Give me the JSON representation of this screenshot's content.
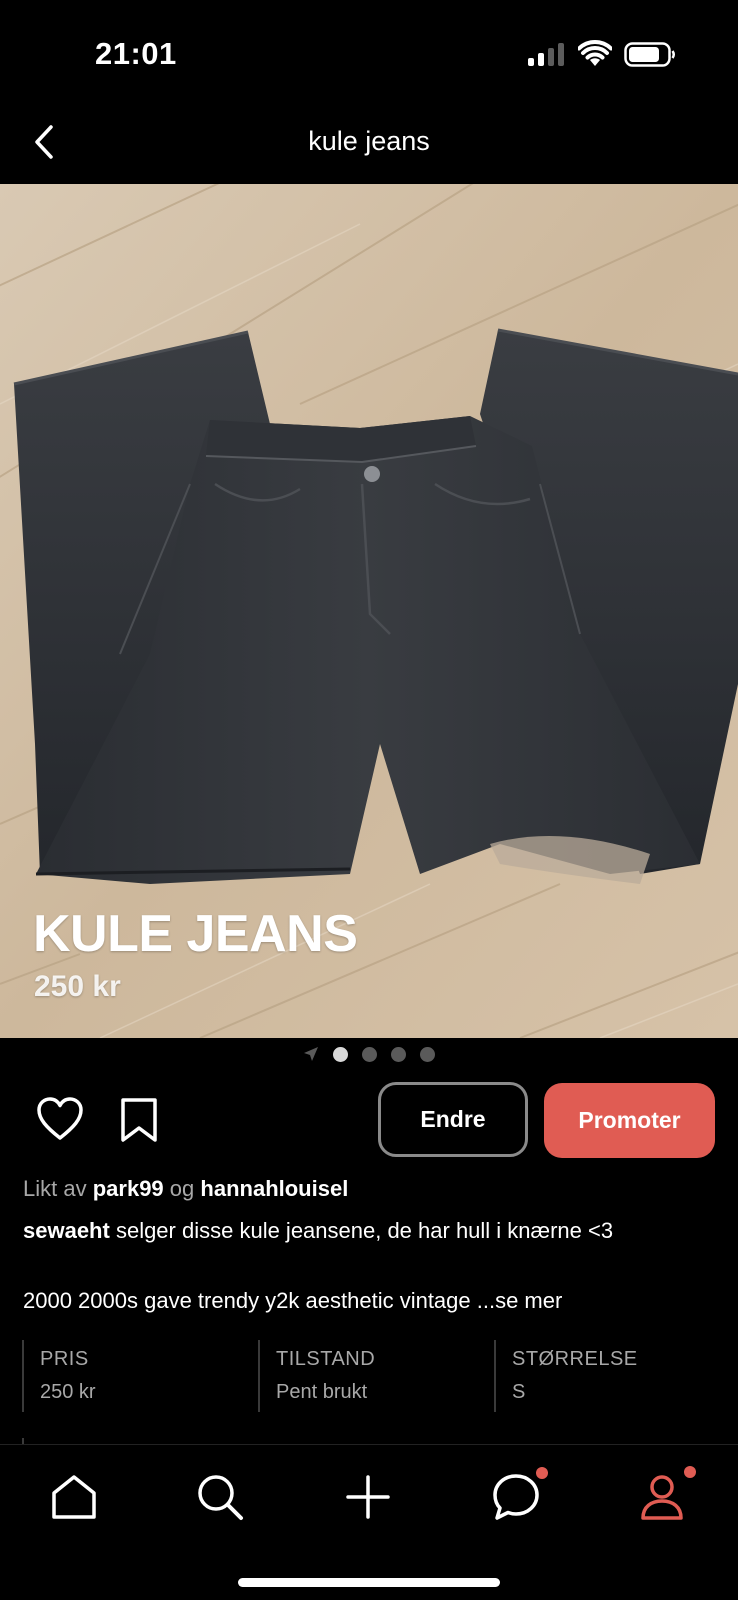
{
  "status_bar": {
    "time": "21:01"
  },
  "header": {
    "title": "kule jeans",
    "back_icon": "chevron-left-icon"
  },
  "photo": {
    "title": "KULE JEANS",
    "price": "250 kr"
  },
  "carousel": {
    "total_dots": 4,
    "active_index": 0
  },
  "actions": {
    "edit_label": "Endre",
    "promote_label": "Promoter"
  },
  "likes": {
    "prefix": "Likt av",
    "user1": "park99",
    "connector": "og",
    "user2": "hannahlouisel"
  },
  "post": {
    "username": "sewaeht",
    "text": "selger disse kule jeansene, de har hull i knærne <3",
    "tags": "2000 2000s gave trendy y2k aesthetic vintage ...se mer"
  },
  "details": [
    {
      "label": "PRIS",
      "value": "250 kr"
    },
    {
      "label": "TILSTAND",
      "value": "Pent brukt"
    },
    {
      "label": "STØRRELSE",
      "value": "S"
    }
  ],
  "tab_bar": {
    "items": [
      "home-icon",
      "search-icon",
      "add-icon",
      "chat-icon",
      "profile-icon"
    ],
    "active": "profile-icon"
  },
  "colors": {
    "accent": "#e05c53",
    "background": "#000000",
    "muted_text": "#a8a8a8"
  }
}
